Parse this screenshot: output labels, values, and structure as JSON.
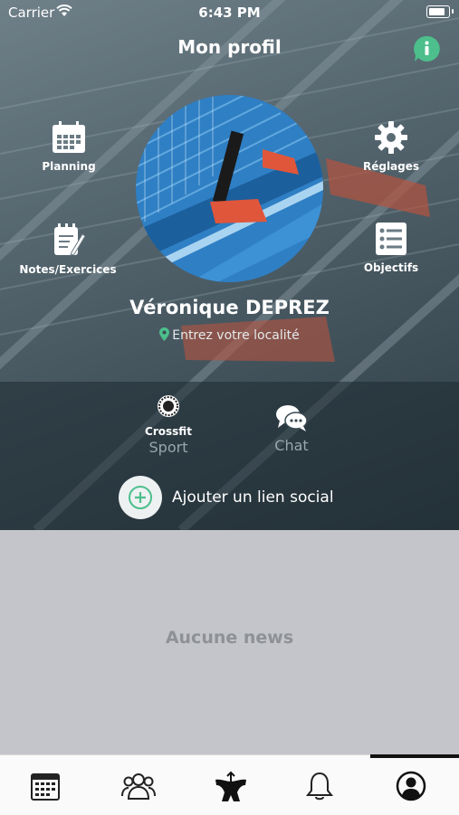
{
  "status_bar": {
    "carrier": "Carrier",
    "time": "6:43 PM"
  },
  "header": {
    "title": "Mon profil"
  },
  "actions": {
    "planning": "Planning",
    "settings": "Réglages",
    "notes": "Notes/Exercices",
    "goals": "Objectifs"
  },
  "profile": {
    "name": "Véronique DEPREZ",
    "location_placeholder": "Entrez votre localité"
  },
  "sport": {
    "name": "Crossfit",
    "caption": "Sport"
  },
  "chat": {
    "caption": "Chat"
  },
  "social": {
    "add_label": "Ajouter un lien social"
  },
  "news": {
    "empty_label": "Aucune news"
  },
  "tabs": [
    {
      "icon": "calendar-icon"
    },
    {
      "icon": "group-icon"
    },
    {
      "icon": "body-icon"
    },
    {
      "icon": "bell-icon"
    },
    {
      "icon": "user-icon",
      "active": true
    }
  ],
  "colors": {
    "accent": "#4cbf8c",
    "panel": "#1e2a32",
    "news_bg": "#c3c5ca",
    "tabbar": "#fafafa"
  }
}
